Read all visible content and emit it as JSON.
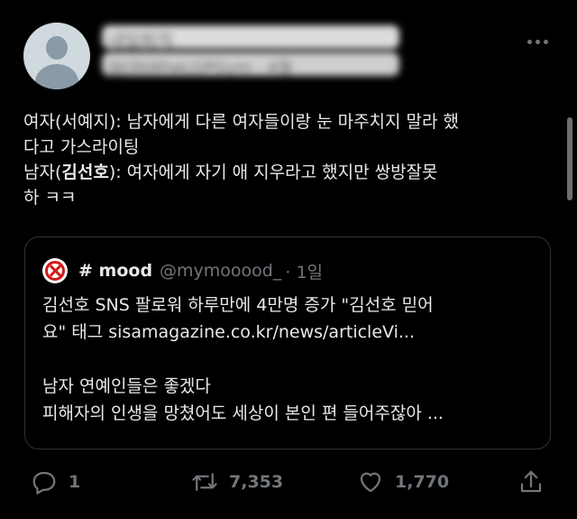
{
  "author": {
    "name_blurred": "내일퇴직",
    "handle_blurred": "@J3bWiwLGPGym · 4월"
  },
  "tweet": {
    "line1": "여자(서예지): 남자에게 다른 여자들이랑 눈 마주치지 말라 했",
    "line2": "다고 가스라이팅",
    "line3_prefix": "남자(",
    "line3_bold": "김선호",
    "line3_suffix": "): 여자에게 자기 애 지우라고 했지만 쌍방잘못",
    "line4": "하 ㅋㅋ"
  },
  "quote": {
    "name": "# mood",
    "handle": "@mymooood_",
    "time": "· 1일",
    "line1": "김선호 SNS 팔로워 하루만에 4만명 증가 \"김선호 믿어",
    "line2": "요\" 태그 sisamagazine.co.kr/news/articleVi...",
    "line3": "남자 연예인들은 좋겠다",
    "line4": "피해자의 인생을 망쳤어도 세상이 본인 편 들어주잖아 ..."
  },
  "actions": {
    "reply_count": "1",
    "retweet_count": "7,353",
    "like_count": "1,770"
  },
  "icons": [
    "more-icon",
    "reply-icon",
    "retweet-icon",
    "like-icon",
    "share-icon"
  ],
  "colors": {
    "background": "#000000",
    "text": "#e7e9ea",
    "muted": "#71767b",
    "border": "#2f3336"
  }
}
